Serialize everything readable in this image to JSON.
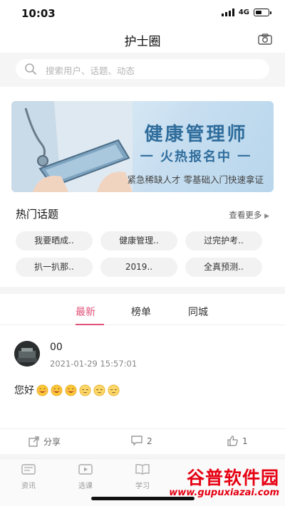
{
  "status_bar": {
    "time": "10:03",
    "network": "4G"
  },
  "nav": {
    "title": "护士圈",
    "camera_icon": "camera-icon"
  },
  "search": {
    "placeholder": "搜索用户、话题、动态"
  },
  "banner": {
    "title": "健康管理师",
    "subtitle": "一 火热报名中 一",
    "description": "紧急稀缺人才  零基础入门快速拿证"
  },
  "hot_topics": {
    "title": "热门话题",
    "see_more": "查看更多",
    "items": [
      "我要晒成..",
      "健康管理..",
      "过完护考..",
      "扒一扒那..",
      "2019..",
      "全真预测.."
    ]
  },
  "feed_tabs": {
    "items": [
      "最新",
      "榜单",
      "同城"
    ],
    "active": "最新"
  },
  "post": {
    "username": "00",
    "time": "2021-01-29 15:57:01",
    "text": "您好",
    "emojis": [
      "smiling-face",
      "smiling-face",
      "smiling-face",
      "relieved-face",
      "relieved-face",
      "relieved-face"
    ],
    "share_label": "分享",
    "comment_count": "2",
    "like_count": "1"
  },
  "tab_bar": {
    "items": [
      "资讯",
      "选课",
      "学习"
    ]
  },
  "watermark": {
    "top": "谷普软件园",
    "bottom": "www.gupuxiazai.com"
  },
  "colors": {
    "accent": "#e1527a",
    "banner_text": "#2f6d9c",
    "watermark": "#e60012"
  }
}
